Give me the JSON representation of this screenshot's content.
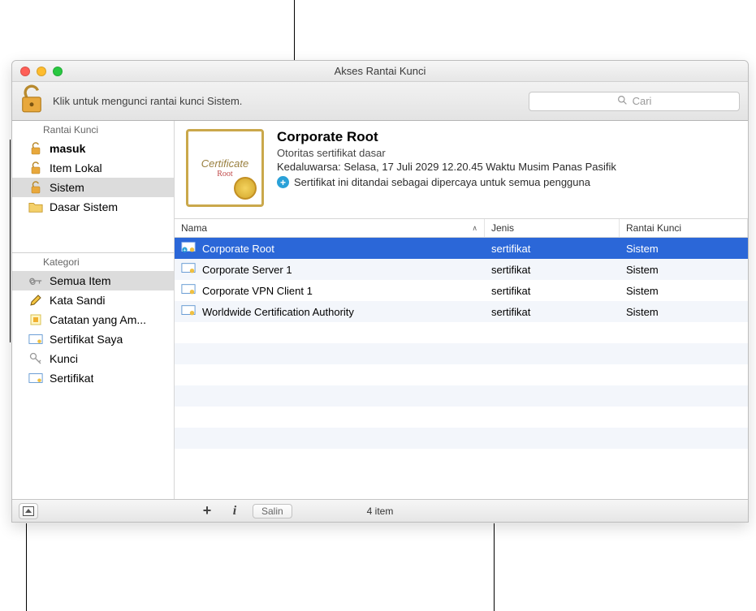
{
  "window": {
    "title": "Akses Rantai Kunci"
  },
  "toolbar": {
    "lock_text": "Klik untuk mengunci rantai kunci Sistem.",
    "search_placeholder": "Cari"
  },
  "sidebar": {
    "keychains_header": "Rantai Kunci",
    "keychains": [
      {
        "label": "masuk",
        "icon": "unlock-icon",
        "bold": true
      },
      {
        "label": "Item Lokal",
        "icon": "unlock-icon"
      },
      {
        "label": "Sistem",
        "icon": "unlock-icon",
        "selected": true
      },
      {
        "label": "Dasar Sistem",
        "icon": "folder-cert-icon"
      }
    ],
    "categories_header": "Kategori",
    "categories": [
      {
        "label": "Semua Item",
        "icon": "keyset-icon",
        "selected": true
      },
      {
        "label": "Kata Sandi",
        "icon": "pencil-icon"
      },
      {
        "label": "Catatan yang Am...",
        "icon": "note-icon"
      },
      {
        "label": "Sertifikat Saya",
        "icon": "mycert-icon"
      },
      {
        "label": "Kunci",
        "icon": "key-icon"
      },
      {
        "label": "Sertifikat",
        "icon": "cert-icon"
      }
    ]
  },
  "details": {
    "name": "Corporate Root",
    "subtitle": "Otoritas sertifikat dasar",
    "expires": "Kedaluwarsa: Selasa, 17 Juli 2029 12.20.45 Waktu Musim Panas Pasifik",
    "trust_status": "Sertifikat ini ditandai sebagai dipercaya untuk semua pengguna",
    "cert_image_text": "Certificate",
    "cert_image_sub": "Root"
  },
  "table": {
    "columns": {
      "name": "Nama",
      "kind": "Jenis",
      "keychain": "Rantai Kunci"
    },
    "rows": [
      {
        "name": "Corporate Root",
        "kind": "sertifikat",
        "keychain": "Sistem",
        "selected": true,
        "plus": true
      },
      {
        "name": "Corporate Server 1",
        "kind": "sertifikat",
        "keychain": "Sistem"
      },
      {
        "name": "Corporate VPN Client 1",
        "kind": "sertifikat",
        "keychain": "Sistem"
      },
      {
        "name": "Worldwide Certification Authority",
        "kind": "sertifikat",
        "keychain": "Sistem"
      }
    ]
  },
  "footer": {
    "copy_label": "Salin",
    "count_label": "4 item"
  }
}
